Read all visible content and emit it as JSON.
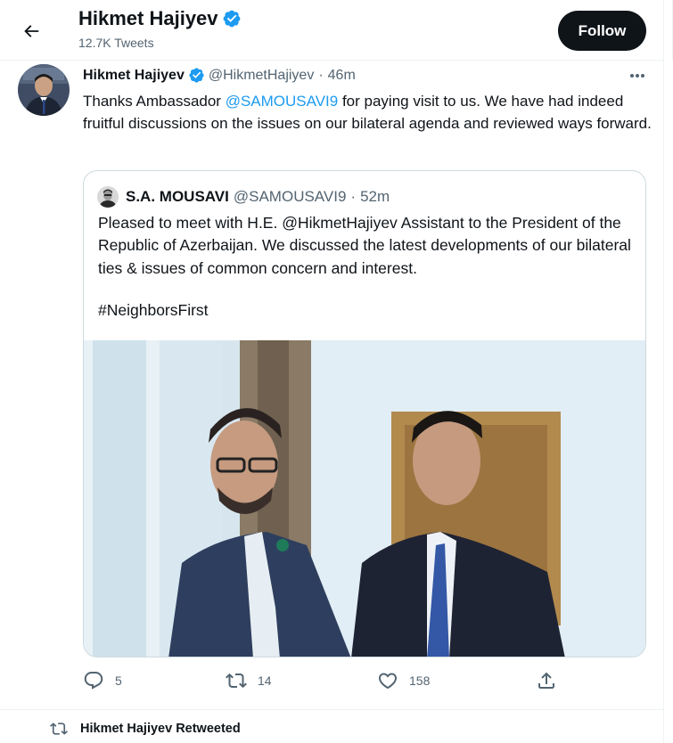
{
  "header": {
    "title": "Hikmet Hajiyev",
    "tweet_count": "12.7K Tweets",
    "follow_label": "Follow"
  },
  "tweet": {
    "author_name": "Hikmet Hajiyev",
    "handle": "@HikmetHajiyev",
    "separator": "·",
    "time": "46m",
    "text_before": "Thanks Ambassador ",
    "mention": "@SAMOUSAVI9",
    "text_after": " for paying visit to us. We have had indeed fruitful discussions on the issues on our bilateral agenda and reviewed ways forward."
  },
  "quoted": {
    "author_name": "S.A. MOUSAVI",
    "handle": "@SAMOUSAVI9",
    "separator": "·",
    "time": "52m",
    "text": "Pleased to meet with H.E. @HikmetHajiyev Assistant to the President of the Republic of Azerbaijan. We discussed the latest developments of our bilateral ties & issues of common concern and interest.",
    "hashtag": "#NeighborsFirst"
  },
  "actions": {
    "replies": "5",
    "retweets": "14",
    "likes": "158"
  },
  "retweet_notice": "Hikmet Hajiyev Retweeted",
  "icons": [
    "back-arrow-icon",
    "verified-badge-icon",
    "more-icon",
    "reply-icon",
    "retweet-icon",
    "like-icon",
    "share-icon"
  ],
  "colors": {
    "accent": "#1d9bf0",
    "follow_bg": "#0f1419",
    "muted": "#536471",
    "border": "#cfd9de"
  }
}
